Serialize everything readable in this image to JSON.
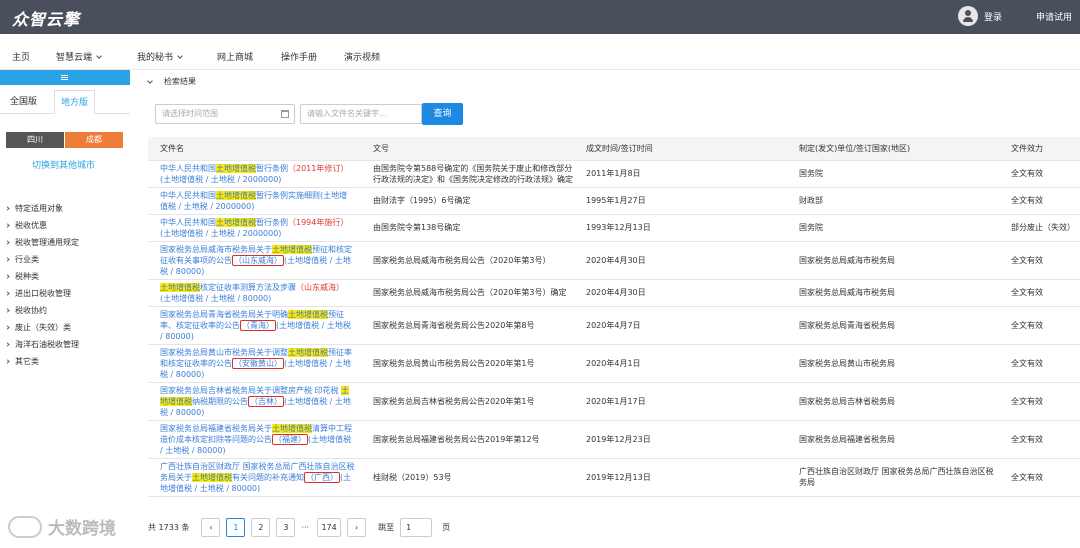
{
  "header": {
    "logo": "众智云擎",
    "login": "登录",
    "trial": "申请试用"
  },
  "nav": [
    "主页",
    "智慧云端",
    "我的秘书",
    "网上商城",
    "操作手册",
    "演示视频"
  ],
  "sidebar": {
    "tabs": [
      "全国版",
      "地方版"
    ],
    "province": "四川",
    "city": "成都",
    "switch_city": "切换到其他城市",
    "items": [
      "特定适用对象",
      "税收优惠",
      "税收管理通用规定",
      "行业类",
      "税种类",
      "进出口税收管理",
      "税收协约",
      "废止（失效）类",
      "海洋石油税收管理",
      "其它类"
    ]
  },
  "search": {
    "breadcrumb": "检索结果",
    "date_placeholder": "请选择时间范围",
    "keyword_placeholder": "请输入文件名关键字...",
    "button": "查询"
  },
  "table": {
    "headers": [
      "文件名",
      "文号",
      "成文时间/签订时间",
      "制定(发文)单位/签订国家(地区)",
      "文件效力"
    ],
    "rows": [
      {
        "pre": "中华人民共和国",
        "hl": "土地增值税",
        "post": "暂行条例",
        "red": "（2011年修订）",
        "box": "",
        "tail": "(土地增值税 / 土地税 / 2000000)",
        "doc": "由国务院令第588号确定的《国务院关于废止和修改部分行政法规的决定》和《国务院决定修改的行政法规》确定",
        "date": "2011年1月8日",
        "unit": "国务院",
        "status": "全文有效"
      },
      {
        "pre": "中华人民共和国",
        "hl": "土地增值税",
        "post": "暂行条例实施细则",
        "red": "",
        "box": "",
        "tail": "(土地增值税 / 土地税 / 2000000)",
        "doc": "由财法字（1995）6号确定",
        "date": "1995年1月27日",
        "unit": "财政部",
        "status": "全文有效"
      },
      {
        "pre": "中华人民共和国",
        "hl": "土地增值税",
        "post": "暂行条例",
        "red": "（1994年施行）",
        "box": "",
        "tail": "(土地增值税 / 土地税 / 2000000)",
        "doc": "由国务院令第138号确定",
        "date": "1993年12月13日",
        "unit": "国务院",
        "status": "部分废止（失效）"
      },
      {
        "pre": "国家税务总局威海市税务局关于",
        "hl": "土地增值税",
        "post": "预征和核定征收有关事项的公告",
        "red": "",
        "box": "（山东威海）",
        "tail": "(土地增值税 / 土地税 / 80000)",
        "doc": "国家税务总局威海市税务局公告（2020年第3号）",
        "date": "2020年4月30日",
        "unit": "国家税务总局威海市税务局",
        "status": "全文有效"
      },
      {
        "pre": "",
        "hl": "土地增值税",
        "post": "核定征收率测算方法及步骤",
        "red": "（山东威海）",
        "box": "",
        "tail": "(土地增值税 / 土地税 / 80000)",
        "doc": "国家税务总局威海市税务局公告（2020年第3号）确定",
        "date": "2020年4月30日",
        "unit": "国家税务总局威海市税务局",
        "status": "全文有效"
      },
      {
        "pre": "国家税务总局青海省税务局关于明确",
        "hl": "土地增值税",
        "post": "预征率、核定征收率的公告",
        "red": "",
        "box": "（青海）",
        "tail": "(土地增值税 / 土地税 / 80000)",
        "doc": "国家税务总局青海省税务局公告2020年第8号",
        "date": "2020年4月7日",
        "unit": "国家税务总局青海省税务局",
        "status": "全文有效"
      },
      {
        "pre": "国家税务总局黄山市税务局关于调整",
        "hl": "土地增值税",
        "post": "预征率和核定征收率的公告",
        "red": "",
        "box": "（安徽黄山）",
        "tail": "(土地增值税 / 土地税 / 80000)",
        "doc": "国家税务总局黄山市税务局公告2020年第1号",
        "date": "2020年4月1日",
        "unit": "国家税务总局黄山市税务局",
        "status": "全文有效"
      },
      {
        "pre": "国家税务总局吉林省税务局关于调整房产税 印花税 ",
        "hl": "土地增值税",
        "post": "纳税期限的公告",
        "red": "",
        "box": "（吉林）",
        "tail": "(土地增值税 / 土地税 / 80000)",
        "doc": "国家税务总局吉林省税务局公告2020年第1号",
        "date": "2020年1月17日",
        "unit": "国家税务总局吉林省税务局",
        "status": "全文有效"
      },
      {
        "pre": "国家税务总局福建省税务局关于",
        "hl": "土地增值税",
        "post": "清算中工程造价成本核定扣除等问题的公告",
        "red": "",
        "box": "（福建）",
        "tail": "(土地增值税 / 土地税 / 80000)",
        "doc": "国家税务总局福建省税务局公告2019年第12号",
        "date": "2019年12月23日",
        "unit": "国家税务总局福建省税务局",
        "status": "全文有效"
      },
      {
        "pre": "广西壮族自治区财政厅 国家税务总局广西壮族自治区税务局关于",
        "hl": "土地增值税",
        "post": "有关问题的补充通知",
        "red": "",
        "box": "（广西）",
        "tail": "(土地增值税 / 土地税 / 80000)",
        "doc": "桂财税（2019）53号",
        "date": "2019年12月13日",
        "unit": "广西壮族自治区财政厅 国家税务总局广西壮族自治区税务局",
        "status": "全文有效"
      }
    ]
  },
  "pagination": {
    "total": "共 1733 条",
    "prev": "‹",
    "pages": [
      "1",
      "2",
      "3"
    ],
    "ellipsis": "···",
    "last": "174",
    "next": "›",
    "goto_label": "跳至",
    "goto_value": "1",
    "page_unit": "页"
  },
  "watermark": "大数跨境"
}
